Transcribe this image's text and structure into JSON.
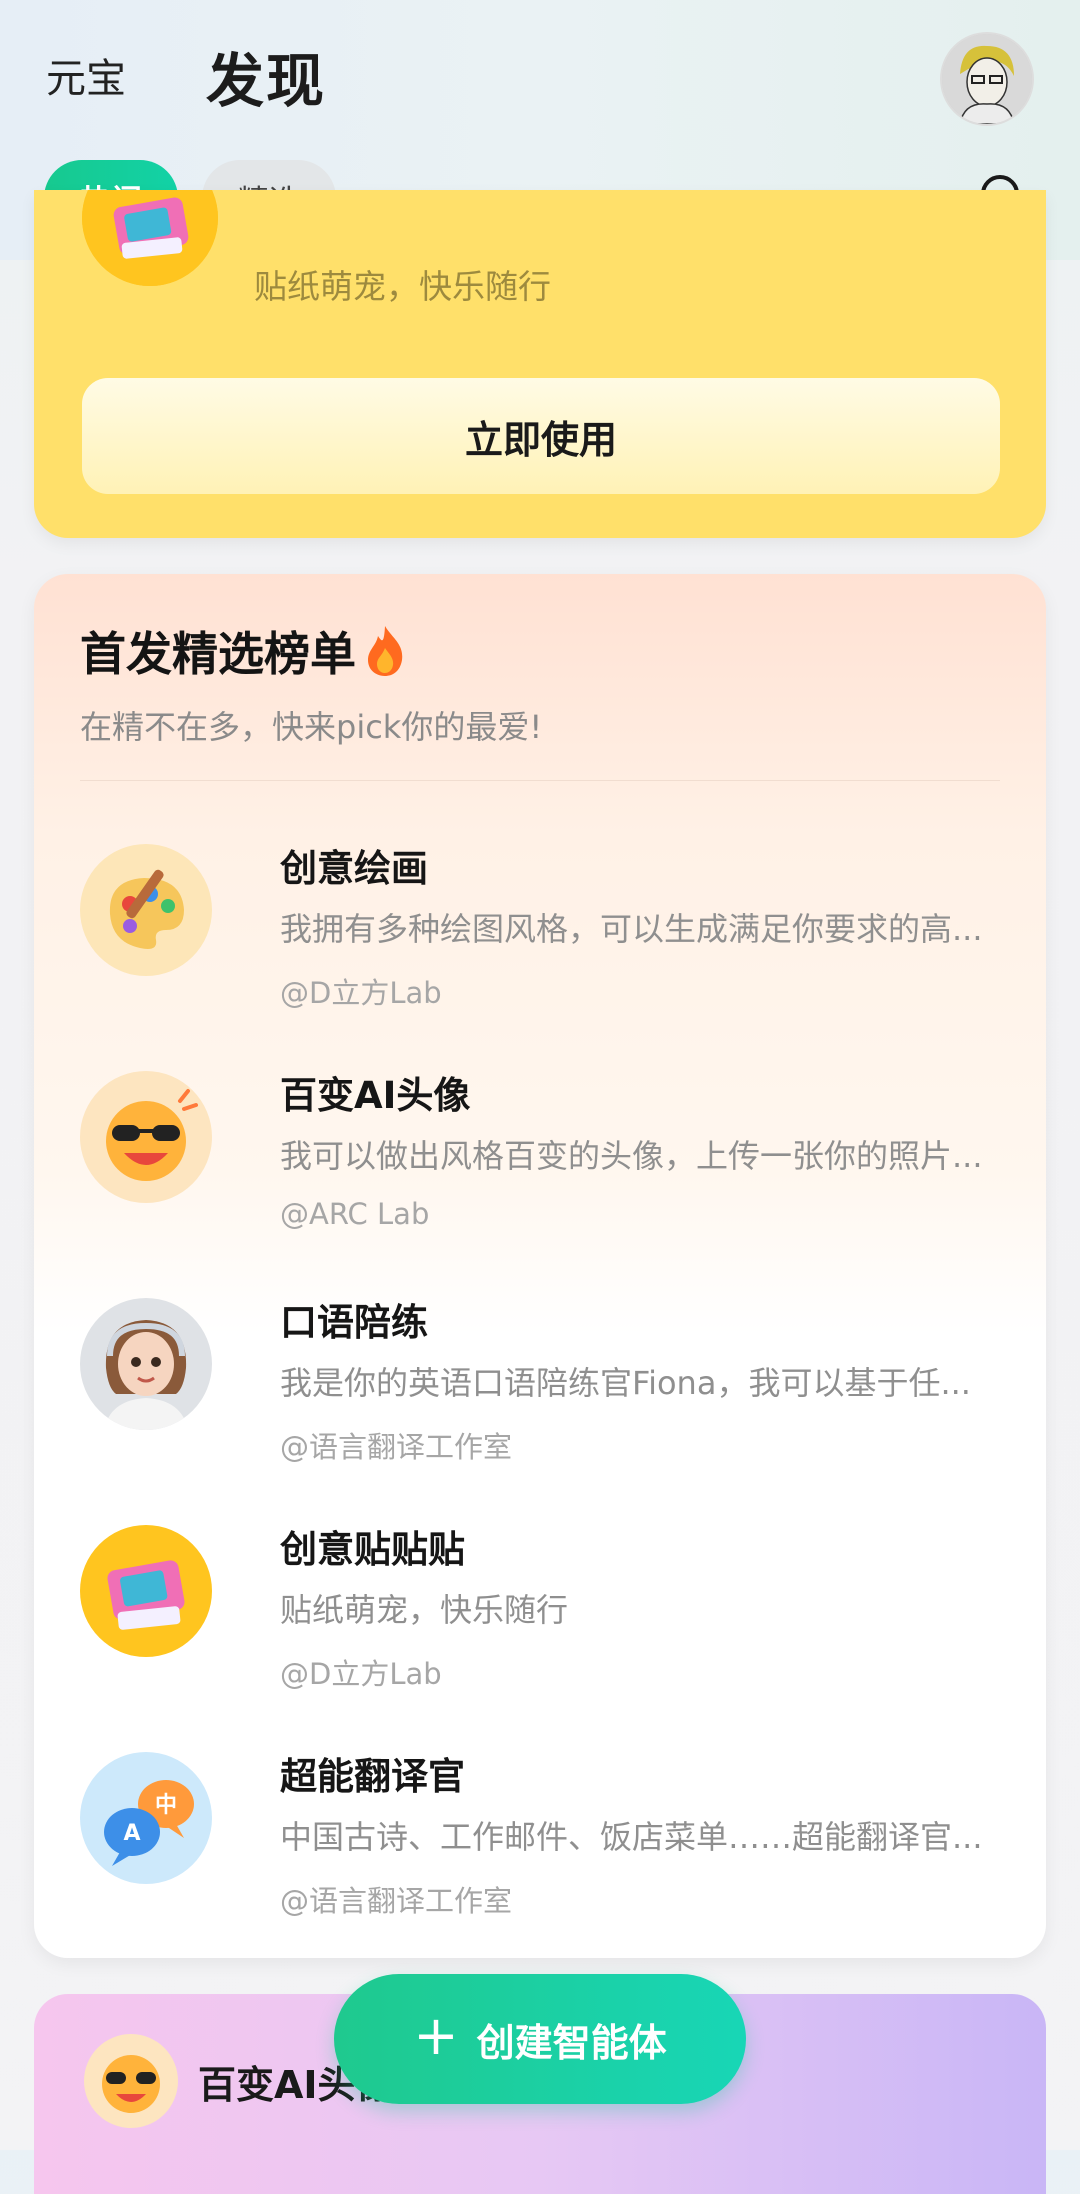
{
  "header": {
    "brand": "元宝",
    "title": "发现"
  },
  "tabs": [
    {
      "label": "热门",
      "active": true
    },
    {
      "label": "精选",
      "active": false
    }
  ],
  "featured_card": {
    "subtitle": "贴纸萌宠，快乐随行",
    "button_label": "立即使用"
  },
  "ranking": {
    "title": "首发精选榜单",
    "subtitle": "在精不在多，快来pick你的最爱!",
    "items": [
      {
        "name": "创意绘画",
        "desc": "我拥有多种绘图风格，可以生成满足你要求的高...",
        "author": "@D立方Lab",
        "icon": "palette-icon"
      },
      {
        "name": "百变AI头像",
        "desc": "我可以做出风格百变的头像，上传一张你的照片...",
        "author": "@ARC Lab",
        "icon": "sunglasses-emoji-icon"
      },
      {
        "name": "口语陪练",
        "desc": "我是你的英语口语陪练官Fiona，我可以基于任...",
        "author": "@语言翻译工作室",
        "icon": "tutor-avatar-icon"
      },
      {
        "name": "创意贴贴贴",
        "desc": "贴纸萌宠，快乐随行",
        "author": "@D立方Lab",
        "icon": "instant-camera-icon"
      },
      {
        "name": "超能翻译官",
        "desc": "中国古诗、工作邮件、饭店菜单……超能翻译官...",
        "author": "@语言翻译工作室",
        "icon": "translate-bubbles-icon"
      }
    ]
  },
  "bottom_card": {
    "name": "百变AI头像"
  },
  "fab": {
    "label": "创建智能体"
  },
  "colors": {
    "accent": "#17c98f",
    "featured_bg": "#ffe06a"
  }
}
